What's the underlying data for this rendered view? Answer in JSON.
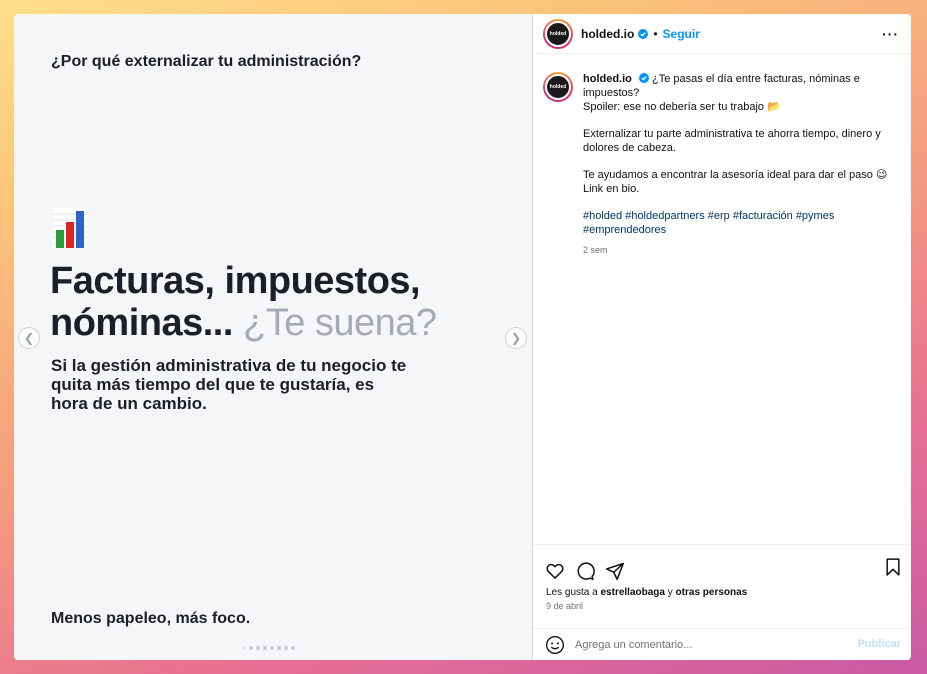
{
  "slide": {
    "question": "¿Por qué externalizar tu administración?",
    "headline_line1": "Facturas, impuestos,",
    "headline_line2_main": "nóminas...",
    "headline_line2_muted": "¿Te suena?",
    "subline": "Si la gestión administrativa de tu negocio te quita más tiempo del que te gustaría, es hora de un cambio.",
    "footer": "Menos papeleo, más foco.",
    "prev_icon": "chevron-left-icon",
    "next_icon": "chevron-right-icon",
    "chart_icon": "bar-chart-icon",
    "bar_colors": [
      "#2a9d3a",
      "#d62828",
      "#2d64c8"
    ]
  },
  "post": {
    "avatar_text": "holded",
    "username": "holded.io",
    "separator": "•",
    "follow_label": "Seguir",
    "more_label": "···",
    "caption": {
      "username": "holded.io",
      "line1": "¿Te pasas el día entre facturas, nóminas e impuestos?",
      "line2": "Spoiler: ese no debería ser tu trabajo 📂",
      "para2": "Externalizar tu parte administrativa te ahorra tiempo, dinero y dolores de cabeza.",
      "para3_a": "Te ayudamos a encontrar la asesoría ideal para dar el paso 😉",
      "para3_b": "Link en bio.",
      "hashtags": "#holded #holdedpartners #erp #facturación #pymes #emprendedores",
      "age": "2 sem"
    },
    "likes_prefix": "Les gusta a",
    "likes_user": "estrellaobaga",
    "likes_and": "y",
    "likes_others": "otras personas",
    "date": "9 de abril",
    "comment_placeholder": "Agrega un comentario...",
    "publish_label": "Publicar",
    "accent_color": "#0095f6"
  }
}
